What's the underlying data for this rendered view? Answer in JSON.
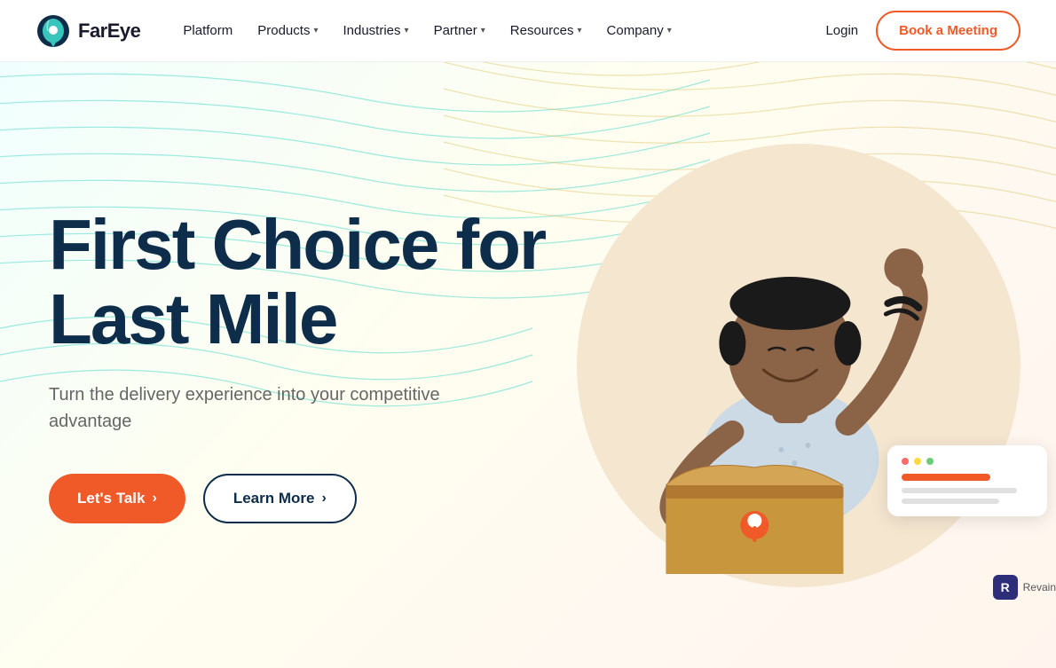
{
  "navbar": {
    "logo_text": "FarEye",
    "nav_items": [
      {
        "label": "Platform",
        "has_dropdown": false
      },
      {
        "label": "Products",
        "has_dropdown": true
      },
      {
        "label": "Industries",
        "has_dropdown": true
      },
      {
        "label": "Partner",
        "has_dropdown": true
      },
      {
        "label": "Resources",
        "has_dropdown": true
      },
      {
        "label": "Company",
        "has_dropdown": true
      }
    ],
    "login_label": "Login",
    "book_button_label": "Book a Meeting"
  },
  "hero": {
    "title": "First Choice for Last Mile",
    "subtitle": "Turn the delivery experience into your competitive advantage",
    "button_primary": "Let's Talk",
    "button_secondary": "Learn More",
    "arrow": "›"
  },
  "revain": {
    "text": "Revain"
  }
}
